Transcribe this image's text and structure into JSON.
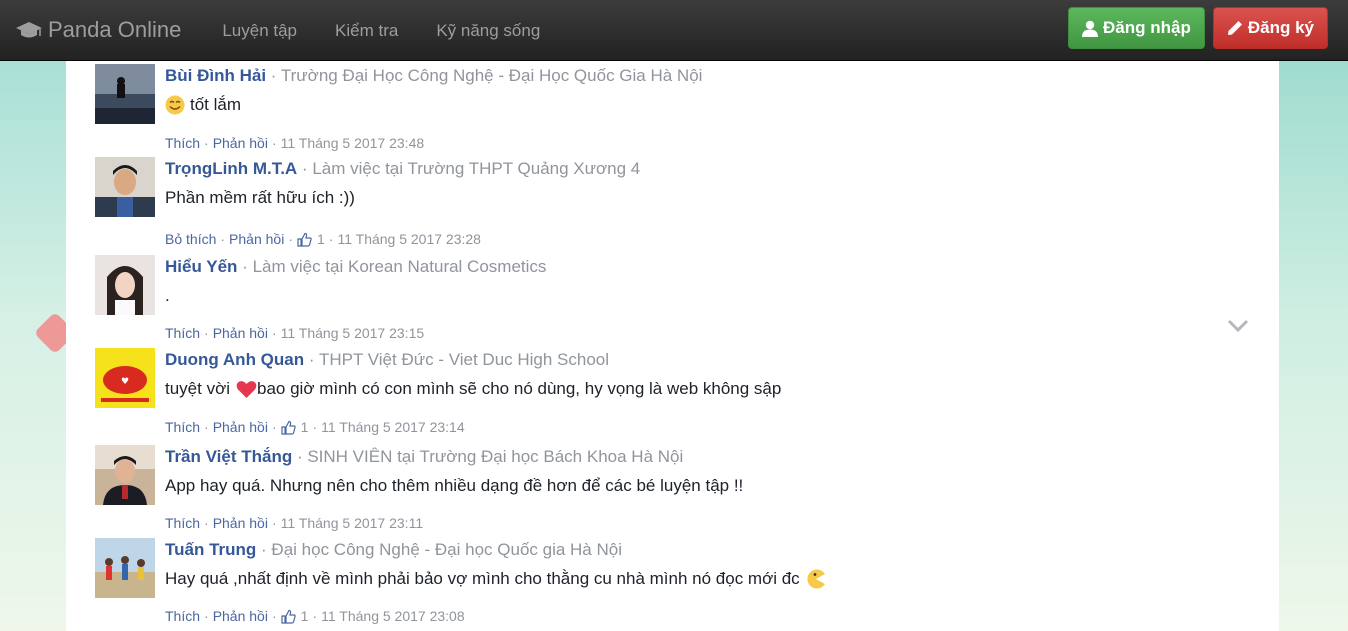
{
  "navbar": {
    "brand": "Panda Online",
    "links": [
      "Luyện tập",
      "Kiểm tra",
      "Kỹ năng sống"
    ],
    "login": "Đăng nhập",
    "register": "Đăng ký",
    "login_color": "#5cb85c",
    "register_color": "#d9534f"
  },
  "comments": [
    {
      "name": "Bùi Đình Hải",
      "affiliation": "Trường Đại Học Công Nghệ - Đại Học Quốc Gia Hà Nội",
      "text": "tốt lắm",
      "emoji": "smile-emoji",
      "action1": "Thích",
      "action2": "Phản hồi",
      "likes": "",
      "time": "11 Tháng 5 2017 23:48"
    },
    {
      "name": "TrọngLinh M.T.A",
      "affiliation": "Làm việc tại Trường THPT Quảng Xương 4",
      "text": "Phần mềm rất hữu ích :))",
      "action1": "Bỏ thích",
      "action2": "Phản hồi",
      "likes": "1",
      "time": "11 Tháng 5 2017 23:28"
    },
    {
      "name": "Hiểu Yến",
      "affiliation": "Làm việc tại Korean Natural Cosmetics",
      "text": ".",
      "action1": "Thích",
      "action2": "Phản hồi",
      "likes": "",
      "time": "11 Tháng 5 2017 23:15"
    },
    {
      "name": "Duong Anh Quan",
      "affiliation": "THPT Việt Đức - Viet Duc High School",
      "text_before": "tuyệt vời",
      "text": "bao giờ mình có con mình sẽ cho nó dùng, hy vọng là web không sập",
      "emoji": "heart-emoji",
      "action1": "Thích",
      "action2": "Phản hồi",
      "likes": "1",
      "time": "11 Tháng 5 2017 23:14"
    },
    {
      "name": "Trần Việt Thắng",
      "affiliation": "SINH VIÊN tại Trường Đại học Bách Khoa Hà Nội",
      "text": "App hay quá. Nhưng nên cho thêm nhiều dạng đề hơn để các bé luyện tập !!",
      "action1": "Thích",
      "action2": "Phản hồi",
      "likes": "",
      "time": "11 Tháng 5 2017 23:11"
    },
    {
      "name": "Tuấn Trung",
      "affiliation": "Đại học Công Nghệ - Đại học Quốc gia Hà Nội",
      "text": "Hay quá ,nhất định về mình phải bảo vợ mình cho thằng cu nhà mình nó đọc mới đc",
      "emoji": "pacman-emoji",
      "action1": "Thích",
      "action2": "Phản hồi",
      "likes": "1",
      "time": "11 Tháng 5 2017 23:08"
    }
  ]
}
